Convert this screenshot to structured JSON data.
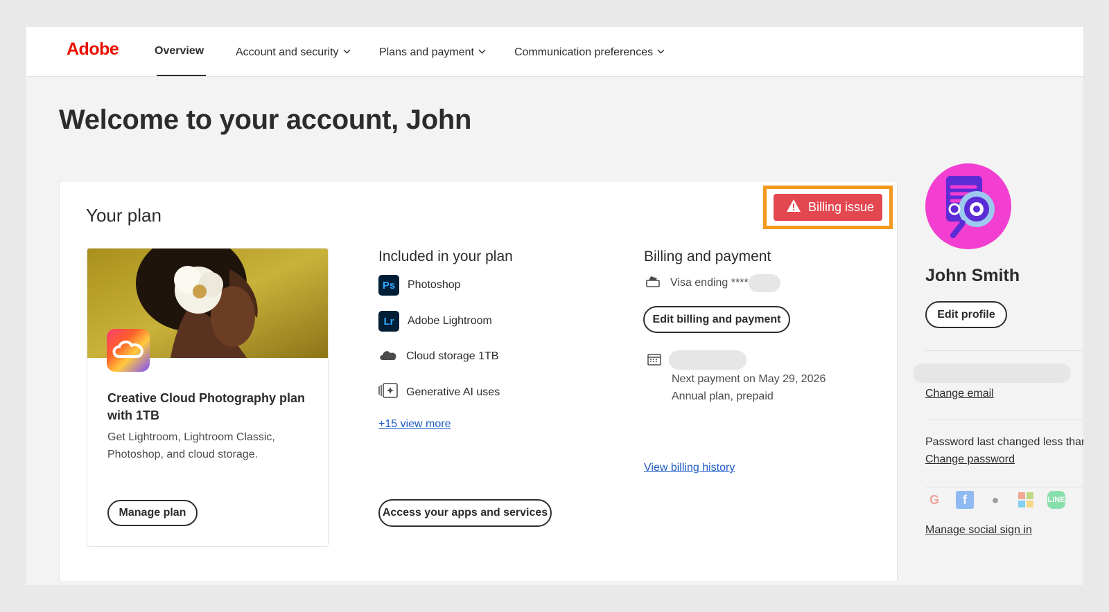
{
  "nav": {
    "logo": "Adobe",
    "overview": "Overview",
    "account_security": "Account and security",
    "plans_payment": "Plans and payment",
    "communication": "Communication preferences"
  },
  "welcome": "Welcome to your account, John",
  "plan": {
    "title": "Your plan",
    "badge": "Billing issue",
    "product_name": "Creative Cloud Photography plan with 1TB",
    "product_desc": "Get Lightroom, Lightroom Classic, Photoshop, and cloud storage.",
    "manage_button": "Manage plan",
    "included_title": "Included in your plan",
    "included": [
      {
        "abbr": "Ps",
        "label": "Photoshop",
        "icon": "photoshop-icon"
      },
      {
        "abbr": "Lr",
        "label": "Adobe Lightroom",
        "icon": "lightroom-icon"
      },
      {
        "label": "Cloud storage 1TB",
        "icon": "cloud-icon"
      },
      {
        "label": "Generative AI uses",
        "icon": "generative-ai-icon"
      }
    ],
    "view_more": "+15 view more",
    "access_button": "Access your apps and services",
    "billing_title": "Billing and payment",
    "card_text": "Visa ending ****",
    "edit_billing_button": "Edit billing and payment",
    "next_payment": "Next payment on May 29, 2026",
    "plan_type": "Annual plan, prepaid",
    "billing_history": "View billing history"
  },
  "profile": {
    "name": "John Smith",
    "edit_button": "Edit profile",
    "change_email": "Change email",
    "password_text": "Password last changed less than",
    "change_password": "Change password",
    "manage_social": "Manage social sign in",
    "social": [
      "google-icon",
      "facebook-icon",
      "apple-icon",
      "microsoft-icon",
      "line-icon"
    ]
  },
  "colors": {
    "adobe_red": "#eb1000",
    "badge_red": "#e34850",
    "highlight_orange": "#f39a1e",
    "link_blue": "#1c5bc7"
  }
}
